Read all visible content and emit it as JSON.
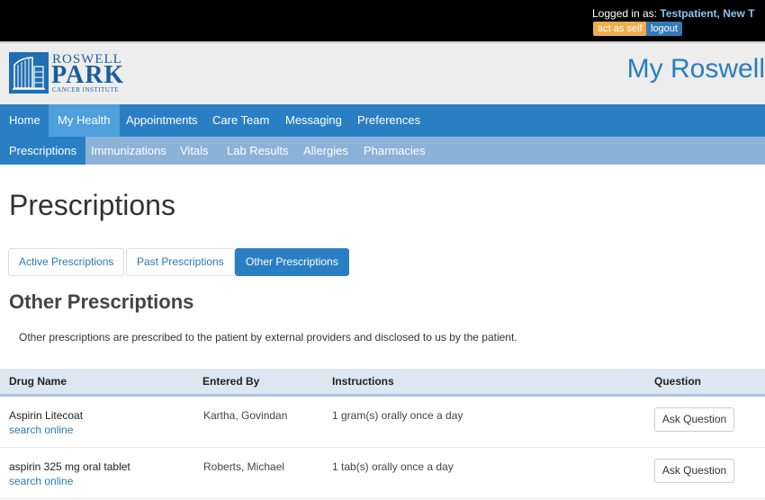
{
  "topbar": {
    "logged_in_label": "Logged in as:",
    "user_name": "Testpatient, New T",
    "act_as_self": "act as self",
    "logout": "logout"
  },
  "header": {
    "logo_line1": "ROSWELL",
    "logo_line2": "PARK",
    "logo_line3": "CANCER INSTITUTE",
    "brand_title": "My Roswell"
  },
  "nav_primary": {
    "items": [
      "Home",
      "My Health",
      "Appointments",
      "Care Team",
      "Messaging",
      "Preferences"
    ],
    "active": "My Health"
  },
  "nav_secondary": {
    "items": [
      "Prescriptions",
      "Immunizations",
      "Vitals",
      "Lab Results",
      "Allergies",
      "Pharmacies"
    ],
    "active": "Prescriptions"
  },
  "page": {
    "title": "Prescriptions",
    "tabs": [
      "Active Prescriptions",
      "Past Prescriptions",
      "Other Prescriptions"
    ],
    "active_tab": "Other Prescriptions",
    "section_title": "Other Prescriptions",
    "description": "Other prescriptions are prescribed to the patient by external providers and disclosed to us by the patient."
  },
  "table": {
    "columns": [
      "Drug Name",
      "Entered By",
      "Instructions",
      "Question"
    ],
    "rows": [
      {
        "drug": "Aspirin Litecoat",
        "search_link": "search online",
        "entered_by": "Kartha, Govindan",
        "instructions": "1 gram(s) orally once a day",
        "question_button": "Ask Question"
      },
      {
        "drug": "aspirin 325 mg oral tablet",
        "search_link": "search online",
        "entered_by": "Roberts, Michael",
        "instructions": "1 tab(s) orally once a day",
        "question_button": "Ask Question"
      }
    ]
  },
  "colors": {
    "nav_primary": "#2a7fc4",
    "nav_active": "#4f9fdc",
    "nav_secondary": "#8db2d8",
    "link": "#2a7ab8",
    "warning": "#f0ad4e"
  }
}
